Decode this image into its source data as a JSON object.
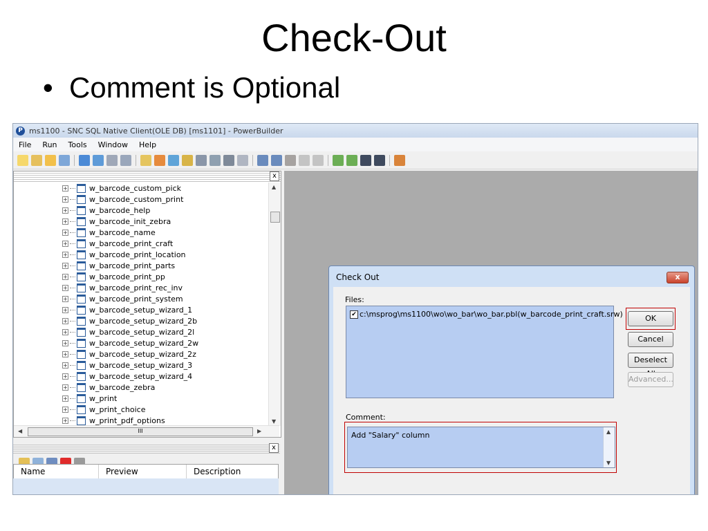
{
  "slide": {
    "title": "Check-Out",
    "bullet": "Comment is Optional"
  },
  "window": {
    "title": "ms1100 - SNC SQL Native Client(OLE DB) [ms1101]  - PowerBuilder",
    "icon": "powerbuilder-icon"
  },
  "menu": [
    "File",
    "Run",
    "Tools",
    "Window",
    "Help"
  ],
  "tree": {
    "items": [
      "w_barcode_custom_pick",
      "w_barcode_custom_print",
      "w_barcode_help",
      "w_barcode_init_zebra",
      "w_barcode_name",
      "w_barcode_print_craft",
      "w_barcode_print_location",
      "w_barcode_print_parts",
      "w_barcode_print_pp",
      "w_barcode_print_rec_inv",
      "w_barcode_print_system",
      "w_barcode_setup_wizard_1",
      "w_barcode_setup_wizard_2b",
      "w_barcode_setup_wizard_2l",
      "w_barcode_setup_wizard_2w",
      "w_barcode_setup_wizard_2z",
      "w_barcode_setup_wizard_3",
      "w_barcode_setup_wizard_4",
      "w_barcode_zebra",
      "w_print",
      "w_print_choice",
      "w_print_pdf_options"
    ],
    "hscroll_label": "III"
  },
  "list": {
    "columns": [
      "Name",
      "Preview",
      "Description"
    ]
  },
  "dialog": {
    "title": "Check Out",
    "close_label": "x",
    "files_label": "Files:",
    "file_path": "c:\\msprog\\ms1100\\wo\\wo_bar\\wo_bar.pbl(w_barcode_print_craft.srw)",
    "file_checked": "✔",
    "buttons": {
      "ok": "OK",
      "cancel": "Cancel",
      "deselect_all": "Deselect All",
      "advanced": "Advanced..."
    },
    "comment_label": "Comment:",
    "comment_value": "Add \"Salary\" column"
  },
  "colors": {
    "highlight": "#c00000",
    "selection": "#b7cdf2"
  }
}
